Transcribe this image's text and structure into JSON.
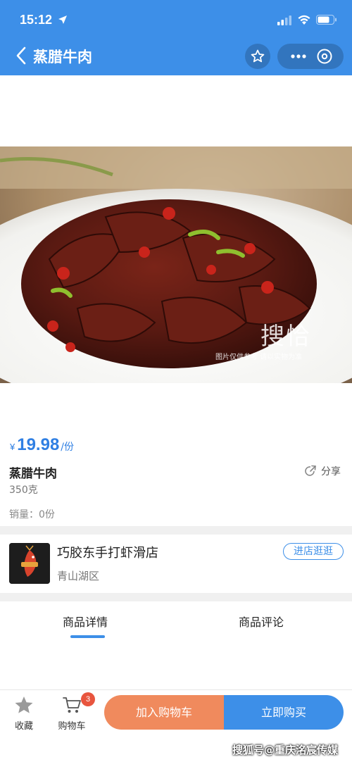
{
  "status_bar": {
    "time": "15:12"
  },
  "nav": {
    "title": "蒸腊牛肉"
  },
  "image_watermark": {
    "brand": "搜恰",
    "note": "图片仅供参考 请以实物为准"
  },
  "product": {
    "currency": "¥",
    "price": "19.98",
    "unit": "/份",
    "name": "蒸腊牛肉",
    "weight": "350克",
    "sales": "销量：0份",
    "share_label": "分享"
  },
  "shop": {
    "name": "巧胶东手打虾滑店",
    "area": "青山湖区",
    "enter_label": "进店逛逛"
  },
  "tabs": [
    {
      "label": "商品详情",
      "active": true
    },
    {
      "label": "商品评论",
      "active": false
    }
  ],
  "bottom_bar": {
    "favorite_label": "收藏",
    "cart_label": "购物车",
    "cart_count": "3",
    "add_to_cart_label": "加入购物车",
    "buy_now_label": "立即购买",
    "corner_mark": "搜狐号@重庆洺宸传媒"
  },
  "colors": {
    "primary": "#3d8fe8",
    "accent_orange": "#f08a5d",
    "badge_red": "#e8553e"
  }
}
